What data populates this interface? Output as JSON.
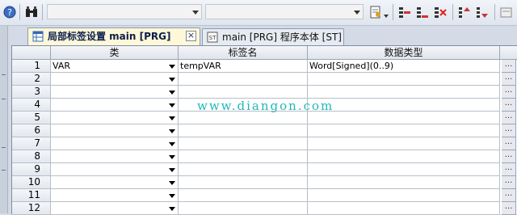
{
  "tabs": [
    {
      "label": "局部标签设置 main [PRG]",
      "active": true
    },
    {
      "label": "main [PRG] 程序本体 [ST]",
      "active": false
    }
  ],
  "columns": {
    "row_header": "",
    "class": "类",
    "label_name": "标签名",
    "data_type": "数据类型"
  },
  "rows": [
    {
      "num": "1",
      "class": "VAR",
      "label": "tempVAR",
      "type": "Word[Signed](0..9)"
    },
    {
      "num": "2",
      "class": "",
      "label": "",
      "type": ""
    },
    {
      "num": "3",
      "class": "",
      "label": "",
      "type": ""
    },
    {
      "num": "4",
      "class": "",
      "label": "",
      "type": ""
    },
    {
      "num": "5",
      "class": "",
      "label": "",
      "type": ""
    },
    {
      "num": "6",
      "class": "",
      "label": "",
      "type": ""
    },
    {
      "num": "7",
      "class": "",
      "label": "",
      "type": ""
    },
    {
      "num": "8",
      "class": "",
      "label": "",
      "type": ""
    },
    {
      "num": "9",
      "class": "",
      "label": "",
      "type": ""
    },
    {
      "num": "10",
      "class": "",
      "label": "",
      "type": ""
    },
    {
      "num": "11",
      "class": "",
      "label": "",
      "type": ""
    },
    {
      "num": "12",
      "class": "",
      "label": "",
      "type": ""
    }
  ],
  "ellipsis_label": "...",
  "watermark": "www.diangon.com",
  "colors": {
    "active_tab_bg": "#fff8d8",
    "watermark": "#22b7b7"
  }
}
